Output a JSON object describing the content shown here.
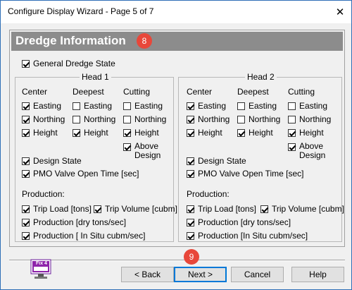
{
  "window": {
    "title": "Configure Display Wizard - Page 5 of 7",
    "close_glyph": "✕"
  },
  "banner": {
    "title": "Dredge Information",
    "badge": "8"
  },
  "general": {
    "label": "General Dredge State",
    "checked": true
  },
  "head1": {
    "title": "Head 1",
    "columns": {
      "center": "Center",
      "deepest": "Deepest",
      "cutting": "Cutting"
    },
    "center": {
      "easting": "Easting",
      "northing": "Northing",
      "height": "Height"
    },
    "deepest": {
      "easting": "Easting",
      "northing": "Northing",
      "height": "Height"
    },
    "cutting": {
      "easting": "Easting",
      "northing": "Northing",
      "height": "Height",
      "above_design": "Above Design"
    },
    "design_state": "Design State",
    "pmo": "PMO Valve Open Time [sec]",
    "production_label": "Production:",
    "trip_load": "Trip Load [tons]",
    "trip_volume": "Trip Volume [cubm]",
    "prod_dry": "Production [dry tons/sec]",
    "prod_insitu": "Production [ In Situ cubm/sec]"
  },
  "head2": {
    "title": "Head 2",
    "columns": {
      "center": "Center",
      "deepest": "Deepest",
      "cutting": "Cutting"
    },
    "center": {
      "easting": "Easting",
      "northing": "Northing",
      "height": "Height"
    },
    "deepest": {
      "easting": "Easting",
      "northing": "Northing",
      "height": "Height"
    },
    "cutting": {
      "easting": "Easting",
      "northing": "Northing",
      "height": "Height",
      "above_design": "Above Design"
    },
    "design_state": "Design State",
    "pmo": "PMO Valve Open Time [sec]",
    "production_label": "Production:",
    "trip_load": "Trip Load [tons]",
    "trip_volume": "Trip Volume [cubm]",
    "prod_dry": "Production [dry tons/sec]",
    "prod_insitu": "Production [In Situ cubm/sec]"
  },
  "footer": {
    "logo_label": "Fix 4",
    "back": "< Back",
    "next": "Next >",
    "cancel": "Cancel",
    "help": "Help",
    "badge": "9"
  },
  "colors": {
    "banner": "#8c8c8c",
    "badge": "#e8473a",
    "accent": "#0078d7"
  }
}
